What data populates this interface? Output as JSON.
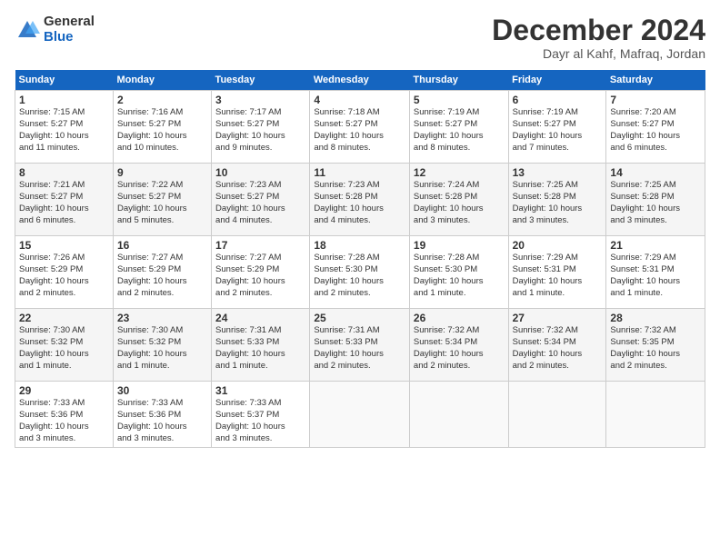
{
  "logo": {
    "general": "General",
    "blue": "Blue"
  },
  "title": "December 2024",
  "location": "Dayr al Kahf, Mafraq, Jordan",
  "days_of_week": [
    "Sunday",
    "Monday",
    "Tuesday",
    "Wednesday",
    "Thursday",
    "Friday",
    "Saturday"
  ],
  "weeks": [
    [
      {
        "day": "1",
        "sunrise": "7:15 AM",
        "sunset": "5:27 PM",
        "daylight": "10 hours and 11 minutes."
      },
      {
        "day": "2",
        "sunrise": "7:16 AM",
        "sunset": "5:27 PM",
        "daylight": "10 hours and 10 minutes."
      },
      {
        "day": "3",
        "sunrise": "7:17 AM",
        "sunset": "5:27 PM",
        "daylight": "10 hours and 9 minutes."
      },
      {
        "day": "4",
        "sunrise": "7:18 AM",
        "sunset": "5:27 PM",
        "daylight": "10 hours and 8 minutes."
      },
      {
        "day": "5",
        "sunrise": "7:19 AM",
        "sunset": "5:27 PM",
        "daylight": "10 hours and 8 minutes."
      },
      {
        "day": "6",
        "sunrise": "7:19 AM",
        "sunset": "5:27 PM",
        "daylight": "10 hours and 7 minutes."
      },
      {
        "day": "7",
        "sunrise": "7:20 AM",
        "sunset": "5:27 PM",
        "daylight": "10 hours and 6 minutes."
      }
    ],
    [
      {
        "day": "8",
        "sunrise": "7:21 AM",
        "sunset": "5:27 PM",
        "daylight": "10 hours and 6 minutes."
      },
      {
        "day": "9",
        "sunrise": "7:22 AM",
        "sunset": "5:27 PM",
        "daylight": "10 hours and 5 minutes."
      },
      {
        "day": "10",
        "sunrise": "7:23 AM",
        "sunset": "5:27 PM",
        "daylight": "10 hours and 4 minutes."
      },
      {
        "day": "11",
        "sunrise": "7:23 AM",
        "sunset": "5:28 PM",
        "daylight": "10 hours and 4 minutes."
      },
      {
        "day": "12",
        "sunrise": "7:24 AM",
        "sunset": "5:28 PM",
        "daylight": "10 hours and 3 minutes."
      },
      {
        "day": "13",
        "sunrise": "7:25 AM",
        "sunset": "5:28 PM",
        "daylight": "10 hours and 3 minutes."
      },
      {
        "day": "14",
        "sunrise": "7:25 AM",
        "sunset": "5:28 PM",
        "daylight": "10 hours and 3 minutes."
      }
    ],
    [
      {
        "day": "15",
        "sunrise": "7:26 AM",
        "sunset": "5:29 PM",
        "daylight": "10 hours and 2 minutes."
      },
      {
        "day": "16",
        "sunrise": "7:27 AM",
        "sunset": "5:29 PM",
        "daylight": "10 hours and 2 minutes."
      },
      {
        "day": "17",
        "sunrise": "7:27 AM",
        "sunset": "5:29 PM",
        "daylight": "10 hours and 2 minutes."
      },
      {
        "day": "18",
        "sunrise": "7:28 AM",
        "sunset": "5:30 PM",
        "daylight": "10 hours and 2 minutes."
      },
      {
        "day": "19",
        "sunrise": "7:28 AM",
        "sunset": "5:30 PM",
        "daylight": "10 hours and 1 minute."
      },
      {
        "day": "20",
        "sunrise": "7:29 AM",
        "sunset": "5:31 PM",
        "daylight": "10 hours and 1 minute."
      },
      {
        "day": "21",
        "sunrise": "7:29 AM",
        "sunset": "5:31 PM",
        "daylight": "10 hours and 1 minute."
      }
    ],
    [
      {
        "day": "22",
        "sunrise": "7:30 AM",
        "sunset": "5:32 PM",
        "daylight": "10 hours and 1 minute."
      },
      {
        "day": "23",
        "sunrise": "7:30 AM",
        "sunset": "5:32 PM",
        "daylight": "10 hours and 1 minute."
      },
      {
        "day": "24",
        "sunrise": "7:31 AM",
        "sunset": "5:33 PM",
        "daylight": "10 hours and 1 minute."
      },
      {
        "day": "25",
        "sunrise": "7:31 AM",
        "sunset": "5:33 PM",
        "daylight": "10 hours and 2 minutes."
      },
      {
        "day": "26",
        "sunrise": "7:32 AM",
        "sunset": "5:34 PM",
        "daylight": "10 hours and 2 minutes."
      },
      {
        "day": "27",
        "sunrise": "7:32 AM",
        "sunset": "5:34 PM",
        "daylight": "10 hours and 2 minutes."
      },
      {
        "day": "28",
        "sunrise": "7:32 AM",
        "sunset": "5:35 PM",
        "daylight": "10 hours and 2 minutes."
      }
    ],
    [
      {
        "day": "29",
        "sunrise": "7:33 AM",
        "sunset": "5:36 PM",
        "daylight": "10 hours and 3 minutes."
      },
      {
        "day": "30",
        "sunrise": "7:33 AM",
        "sunset": "5:36 PM",
        "daylight": "10 hours and 3 minutes."
      },
      {
        "day": "31",
        "sunrise": "7:33 AM",
        "sunset": "5:37 PM",
        "daylight": "10 hours and 3 minutes."
      },
      null,
      null,
      null,
      null
    ]
  ],
  "labels": {
    "sunrise": "Sunrise:",
    "sunset": "Sunset:",
    "daylight": "Daylight:"
  }
}
